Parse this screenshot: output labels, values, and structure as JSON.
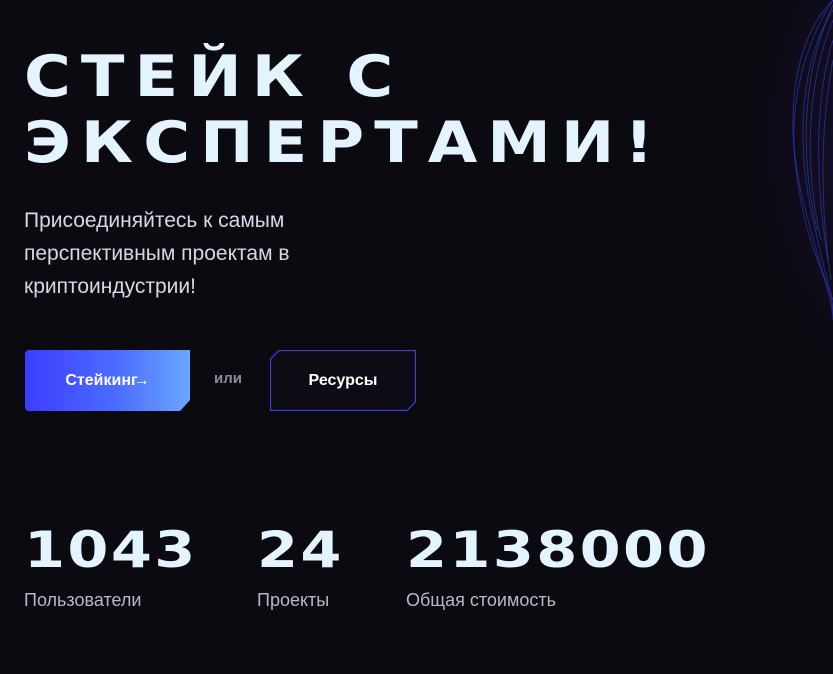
{
  "hero": {
    "title_line1": "Стейк с",
    "title_line2": "экспертами!",
    "subtitle": "Присоединяйтесь к самым перспективным проектам в криптоиндустрии!"
  },
  "actions": {
    "stake_label": "Стейкинг",
    "stake_arrow": "→",
    "or_text": "или",
    "resources_label": "Ресурсы"
  },
  "stats": [
    {
      "value": "1043",
      "label": "Пользователи"
    },
    {
      "value": "24",
      "label": "Проекты"
    },
    {
      "value": "2138000",
      "label": "Общая стоимость"
    }
  ],
  "colors": {
    "background": "#0b0a10",
    "headline": "#e3f4ff",
    "accent_start": "#3d3cff",
    "accent_end": "#6aa6ff",
    "outline": "#3b3fe8"
  }
}
